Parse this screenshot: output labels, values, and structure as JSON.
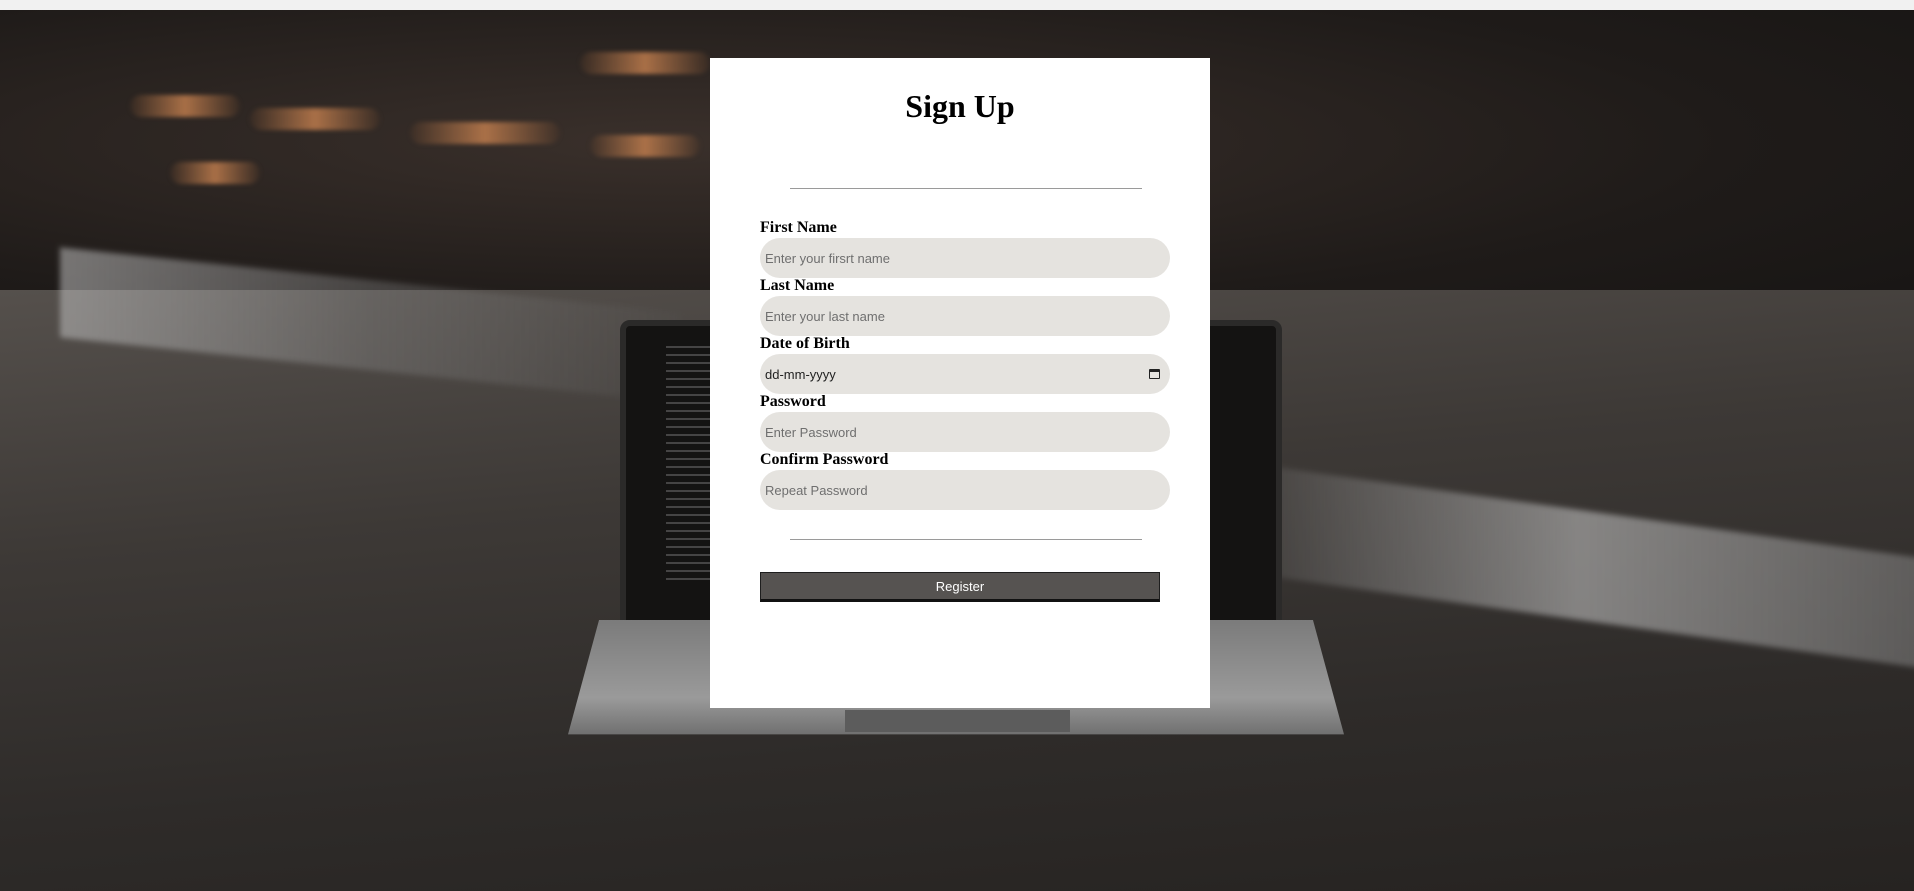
{
  "form": {
    "title": "Sign Up",
    "fields": [
      {
        "label": "First Name",
        "placeholder": "Enter your firsrt name"
      },
      {
        "label": "Last Name",
        "placeholder": "Enter your last name"
      },
      {
        "label": "Date of Birth",
        "placeholder": "dd-mm-yyyy"
      },
      {
        "label": "Password",
        "placeholder": "Enter Password"
      },
      {
        "label": "Confirm Password",
        "placeholder": "Repeat Password"
      }
    ],
    "submit_label": "Register"
  },
  "icons": {
    "date_picker": "calendar-icon"
  }
}
